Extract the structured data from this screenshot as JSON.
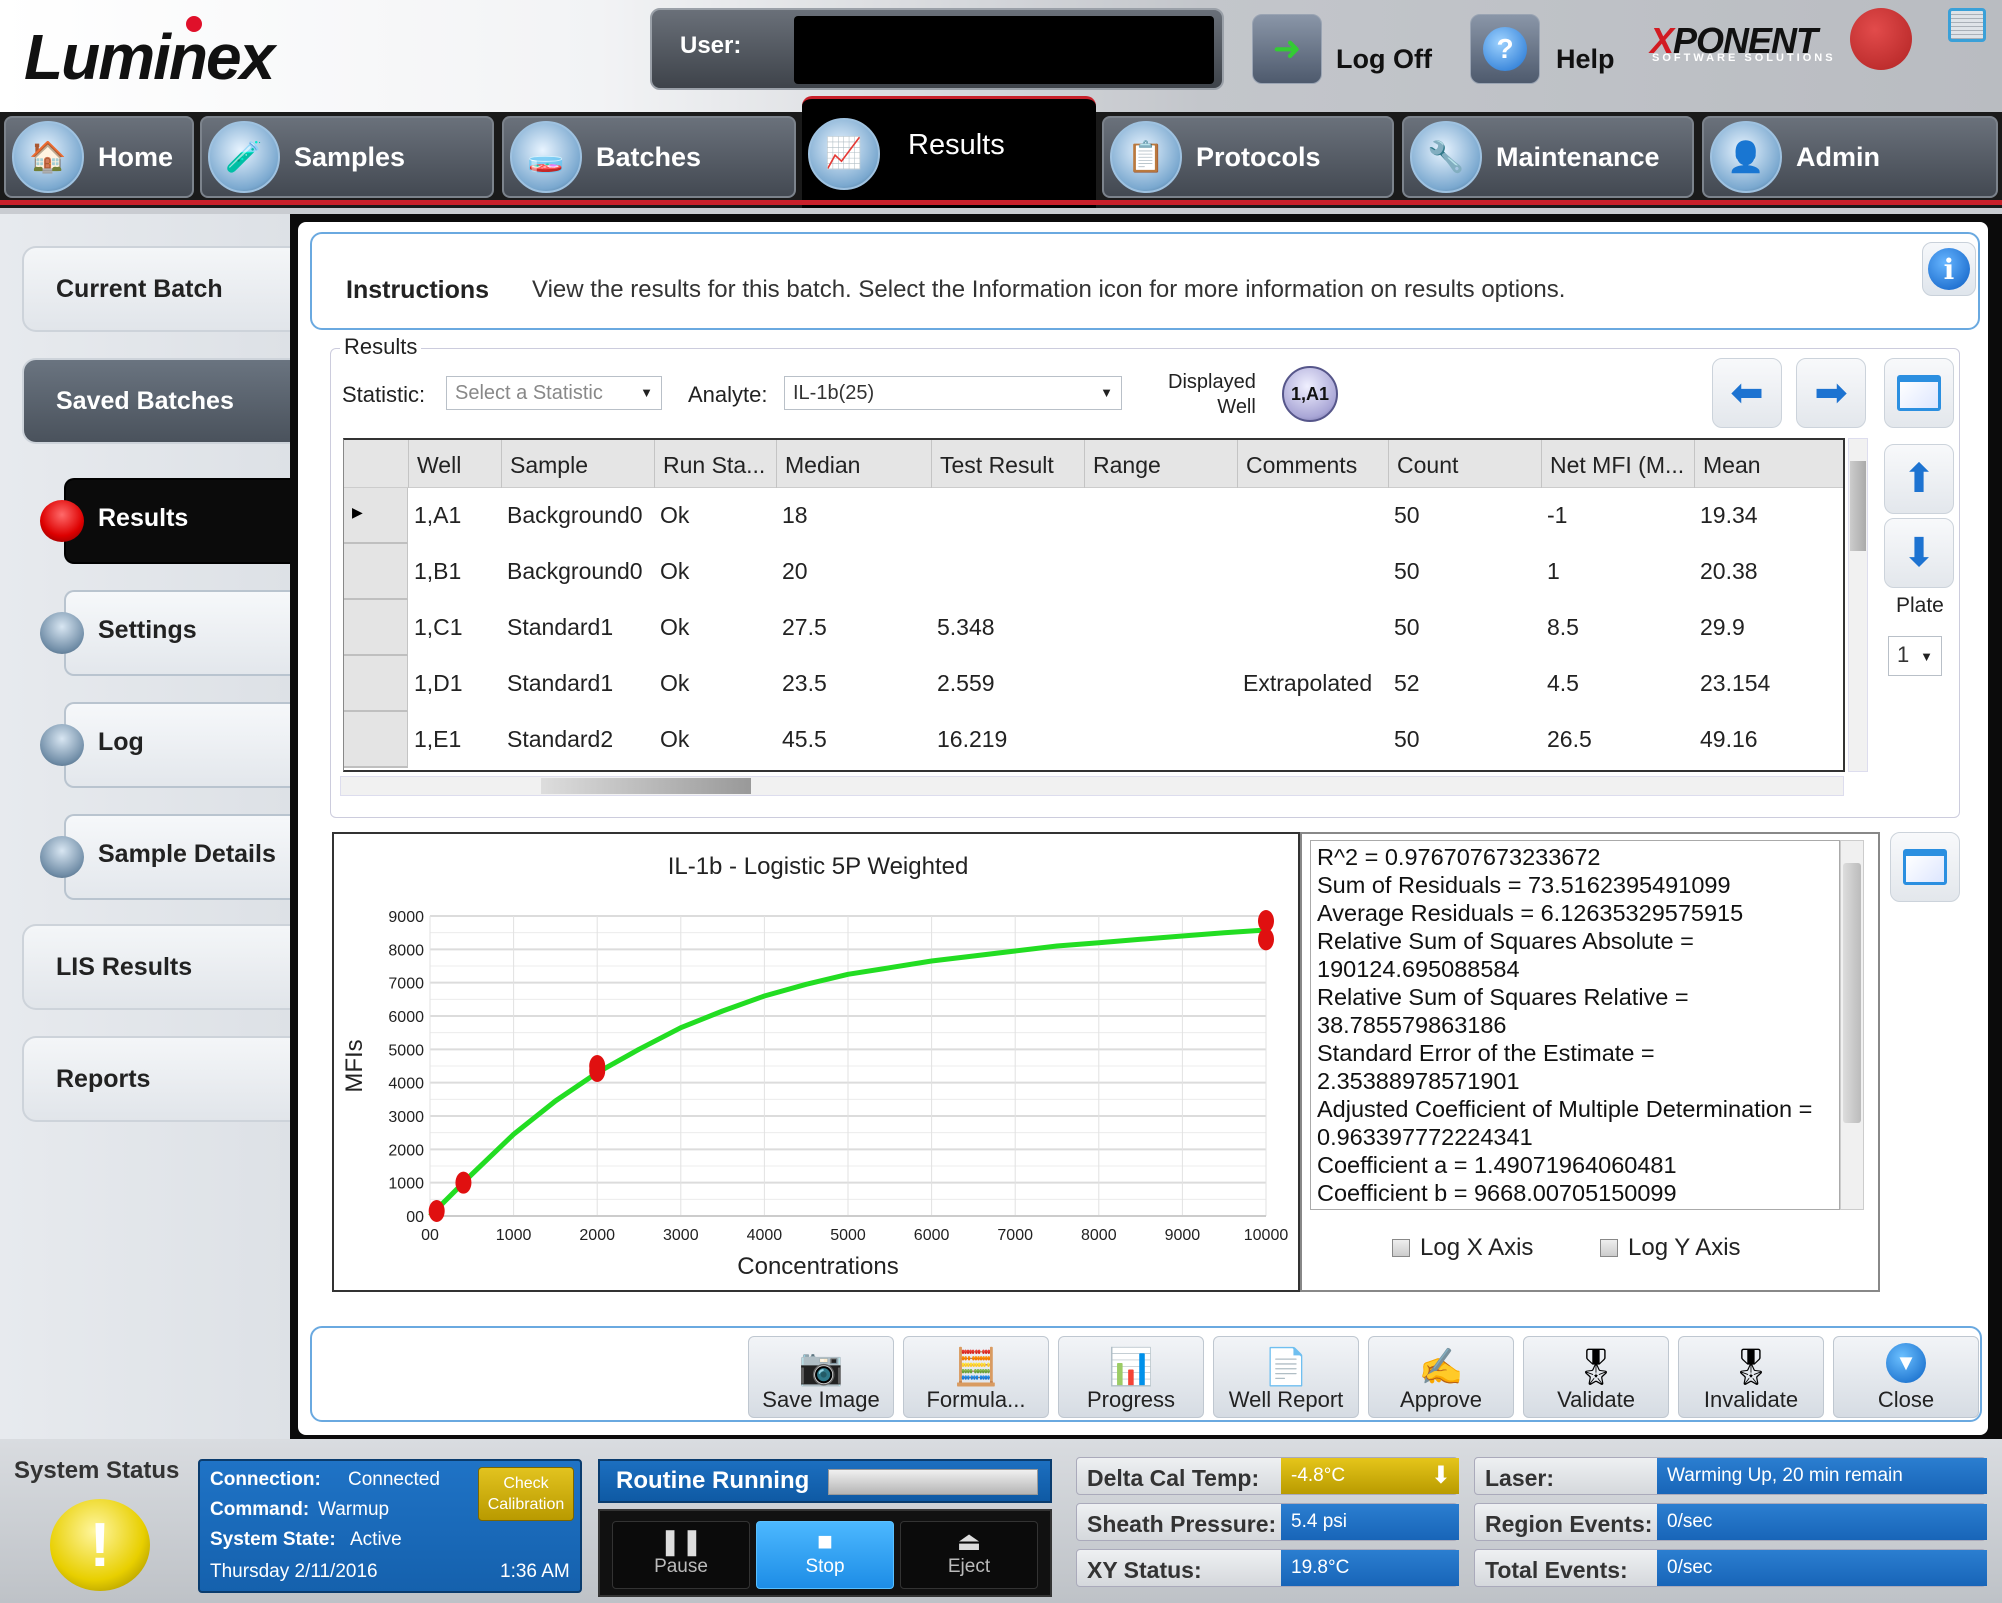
{
  "header": {
    "logo": "Luminex",
    "user_label": "User:",
    "user_value": "",
    "log_off_label": "Log Off",
    "help_label": "Help",
    "brand": "XPONENT",
    "brand_sub": "SOFTWARE SOLUTIONS"
  },
  "nav": {
    "tabs": [
      {
        "label": "Home",
        "icon": "home-icon"
      },
      {
        "label": "Samples",
        "icon": "test-tubes-icon"
      },
      {
        "label": "Batches",
        "icon": "plate-icon"
      },
      {
        "label": "Results",
        "icon": "chart-icon",
        "active": true
      },
      {
        "label": "Protocols",
        "icon": "list-icon"
      },
      {
        "label": "Maintenance",
        "icon": "tools-icon"
      },
      {
        "label": "Admin",
        "icon": "user-icon"
      }
    ]
  },
  "sidebar": {
    "items": [
      {
        "label": "Current Batch"
      },
      {
        "label": "Saved Batches",
        "selected": true
      },
      {
        "label": "Results",
        "active": true
      },
      {
        "label": "Settings"
      },
      {
        "label": "Log"
      },
      {
        "label": "Sample Details"
      },
      {
        "label": "LIS Results"
      },
      {
        "label": "Reports"
      }
    ]
  },
  "instructions": {
    "label": "Instructions",
    "text": "View the results for this batch. Select the Information icon for more information on results options."
  },
  "results": {
    "group_label": "Results",
    "statistic_label": "Statistic:",
    "statistic_placeholder": "Select a Statistic",
    "analyte_label": "Analyte:",
    "analyte_value": "IL-1b(25)",
    "displayed_well_label_1": "Displayed",
    "displayed_well_label_2": "Well",
    "displayed_well": "1,A1",
    "plate_label": "Plate",
    "plate_value": "1",
    "columns": [
      "Well",
      "Sample",
      "Run Sta...",
      "Median",
      "Test Result",
      "Range",
      "Comments",
      "Count",
      "Net MFI (M...",
      "Mean"
    ],
    "rows": [
      [
        "1,A1",
        "Background0",
        "Ok",
        "18",
        "",
        "",
        "",
        "50",
        "-1",
        "19.34"
      ],
      [
        "1,B1",
        "Background0",
        "Ok",
        "20",
        "",
        "",
        "",
        "50",
        "1",
        "20.38"
      ],
      [
        "1,C1",
        "Standard1",
        "Ok",
        "27.5",
        "5.348",
        "",
        "",
        "50",
        "8.5",
        "29.9"
      ],
      [
        "1,D1",
        "Standard1",
        "Ok",
        "23.5",
        "2.559",
        "",
        "Extrapolated",
        "52",
        "4.5",
        "23.154"
      ],
      [
        "1,E1",
        "Standard2",
        "Ok",
        "45.5",
        "16.219",
        "",
        "",
        "50",
        "26.5",
        "49.16"
      ]
    ],
    "selected_row": 0
  },
  "chart_data": {
    "type": "scatter",
    "title": "IL-1b - Logistic 5P Weighted",
    "xlabel": "Concentrations",
    "ylabel": "MFIs",
    "xlim": [
      0,
      10000
    ],
    "ylim": [
      0,
      9000
    ],
    "xticks": [
      "00",
      "1000",
      "2000",
      "3000",
      "4000",
      "5000",
      "6000",
      "7000",
      "8000",
      "9000",
      "10000"
    ],
    "yticks": [
      "00",
      "1000",
      "2000",
      "3000",
      "4000",
      "5000",
      "6000",
      "7000",
      "8000",
      "9000"
    ],
    "grid": true,
    "series": [
      {
        "name": "standards",
        "kind": "points",
        "color": "#e01010",
        "x": [
          80,
          400,
          2000,
          2000,
          10000,
          10000
        ],
        "y": [
          150,
          1000,
          4350,
          4500,
          8300,
          8850
        ]
      },
      {
        "name": "fit curve",
        "kind": "line",
        "color": "#22dd22",
        "x": [
          0,
          500,
          1000,
          1500,
          2000,
          2500,
          3000,
          3500,
          4000,
          4500,
          5000,
          5500,
          6000,
          6500,
          7000,
          7500,
          8000,
          8500,
          9000,
          9500,
          10000
        ],
        "y": [
          0,
          1250,
          2450,
          3450,
          4300,
          5000,
          5650,
          6150,
          6600,
          6950,
          7250,
          7450,
          7650,
          7800,
          7950,
          8100,
          8200,
          8300,
          8400,
          8500,
          8580
        ]
      }
    ]
  },
  "stats": {
    "lines": [
      "R^2 = 0.976707673233672",
      "Sum of Residuals = 73.5162395491099",
      "Average Residuals = 6.12635329575915",
      "Relative Sum of Squares Absolute =",
      "190124.695088584",
      "Relative Sum of Squares Relative =",
      "38.785579863186",
      "Standard Error of the Estimate =",
      "2.35388978571901",
      "Adjusted Coefficient of Multiple Determination =",
      "0.963397772224341",
      "Coefficient a = 1.49071964060481",
      "Coefficient b = 9668.00705150099"
    ],
    "log_x_label": "Log X Axis",
    "log_y_label": "Log Y Axis",
    "log_x_checked": false,
    "log_y_checked": false
  },
  "actions": [
    {
      "label": "Save Image",
      "icon": "camera-save-icon",
      "glyph": "📷"
    },
    {
      "label": "Formula...",
      "icon": "formula-icon",
      "glyph": "🧮"
    },
    {
      "label": "Progress",
      "icon": "progress-chart-icon",
      "glyph": "📊"
    },
    {
      "label": "Well Report",
      "icon": "well-report-icon",
      "glyph": "📄"
    },
    {
      "label": "Approve",
      "icon": "approve-icon",
      "glyph": "✍"
    },
    {
      "label": "Validate",
      "icon": "validate-ribbon-icon",
      "glyph": "🎖"
    },
    {
      "label": "Invalidate",
      "icon": "invalidate-ribbon-icon",
      "glyph": "🎖"
    },
    {
      "label": "Close",
      "icon": "close-circle-icon",
      "glyph": "▼"
    }
  ],
  "status": {
    "system_status_label": "System Status",
    "connection_label": "Connection:",
    "connection_value": "Connected",
    "command_label": "Command:",
    "command_value": "Warmup",
    "state_label": "System State:",
    "state_value": "Active",
    "date": "Thursday 2/11/2016",
    "time": "1:36 AM",
    "check_calibration_1": "Check",
    "check_calibration_2": "Calibration",
    "routine_label": "Routine Running",
    "pause_label": "Pause",
    "stop_label": "Stop",
    "eject_label": "Eject",
    "delta_cal_label": "Delta Cal Temp:",
    "delta_cal_value": "-4.8°C",
    "sheath_label": "Sheath Pressure:",
    "sheath_value": "5.4 psi",
    "xy_label": "XY Status:",
    "xy_value": "19.8°C",
    "laser_label": "Laser:",
    "laser_value": "Warming Up, 20 min remain",
    "region_label": "Region Events:",
    "region_value": "0/sec",
    "total_label": "Total Events:",
    "total_value": "0/sec"
  }
}
